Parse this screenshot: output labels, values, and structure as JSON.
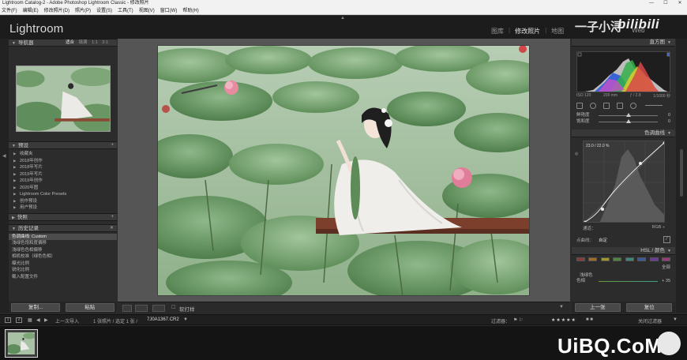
{
  "window": {
    "title": "Lightroom Catalog-2 - Adobe Photoshop Lightroom Classic - 修改照片",
    "controls": [
      "—",
      "☐",
      "✕"
    ]
  },
  "menu": [
    "文件(F)",
    "编辑(E)",
    "修改照片(D)",
    "照片(P)",
    "设置(S)",
    "工具(T)",
    "视图(V)",
    "窗口(W)",
    "帮助(H)"
  ],
  "identity": {
    "app_name": "Lightroom",
    "watermark_cn": "一子小浔",
    "watermark_bili": "bilibili",
    "modules": [
      "图库",
      "修改照片",
      "地图"
    ],
    "modules_trailing": "Web"
  },
  "left_panel": {
    "navigator": {
      "title": "导航器",
      "options": [
        "适合",
        "填满",
        "1:1",
        "3:1"
      ]
    },
    "presets": {
      "title": "预设",
      "items": [
        "收藏夹",
        "2018年创作",
        "2018年写片",
        "2019年写片",
        "2019年创作",
        "2020年图",
        "Lightroom Color Presets",
        "创作预设",
        "用户预设"
      ]
    },
    "snapshots": {
      "title": "快照"
    },
    "history": {
      "title": "历史记录",
      "items": [
        {
          "label": "色调曲线: Custom",
          "old": "",
          "new": ""
        },
        {
          "label": "浅绿色饱和度偏移",
          "old": "",
          "new": ""
        },
        {
          "label": "浅绿色色相偏移",
          "old": "",
          "new": ""
        },
        {
          "label": "相机校准（绿色色相）",
          "old": "",
          "new": ""
        },
        {
          "label": "曝光比例",
          "old": "",
          "new": ""
        },
        {
          "label": "锐化比例",
          "old": "",
          "new": ""
        },
        {
          "label": "载入配置文件",
          "old": "",
          "new": ""
        }
      ]
    },
    "buttons": {
      "copy": "复制...",
      "paste": "粘贴"
    }
  },
  "toolbar": {
    "soft_proof": "软打样"
  },
  "right_panel": {
    "histogram": {
      "title": "直方图",
      "info": [
        "ISO 120",
        "200 mm",
        "ƒ / 2.8",
        "1/1000 秒"
      ]
    },
    "sliders": [
      {
        "name": "鲜艳度",
        "pos": 0.5,
        "value": "0"
      },
      {
        "name": "饱和度",
        "pos": 0.5,
        "value": "0"
      }
    ],
    "tone_curve": {
      "title": "色调曲线",
      "readout": "23.0 / 22.0 %",
      "channel_label": "通道：",
      "channel_value": "RGB ÷",
      "region_label": "点曲线：",
      "region_value": "自定"
    },
    "hsl": {
      "title": "HSL / 颜色",
      "swatches": [
        "#8a3a3a",
        "#a06a2a",
        "#a0982a",
        "#4a8a3a",
        "#3a8a7a",
        "#3a5a9a",
        "#6a3a9a",
        "#9a3a7a"
      ],
      "tab": "全部",
      "sub": "浅绿色",
      "slider_name": "色相",
      "slider_value": "+ 35"
    },
    "buttons": {
      "previous": "上一张",
      "reset": "复位"
    }
  },
  "filmbar": {
    "pages": [
      "1",
      "2"
    ],
    "nav": "上一次导入",
    "count": "1 张照片 / 选定 1 张 /",
    "filename": "7J0A1367.CR2",
    "filter_label": "过滤器：",
    "filter_state": "关闭过滤器"
  },
  "watermark_site": "UiBQ.CoM"
}
